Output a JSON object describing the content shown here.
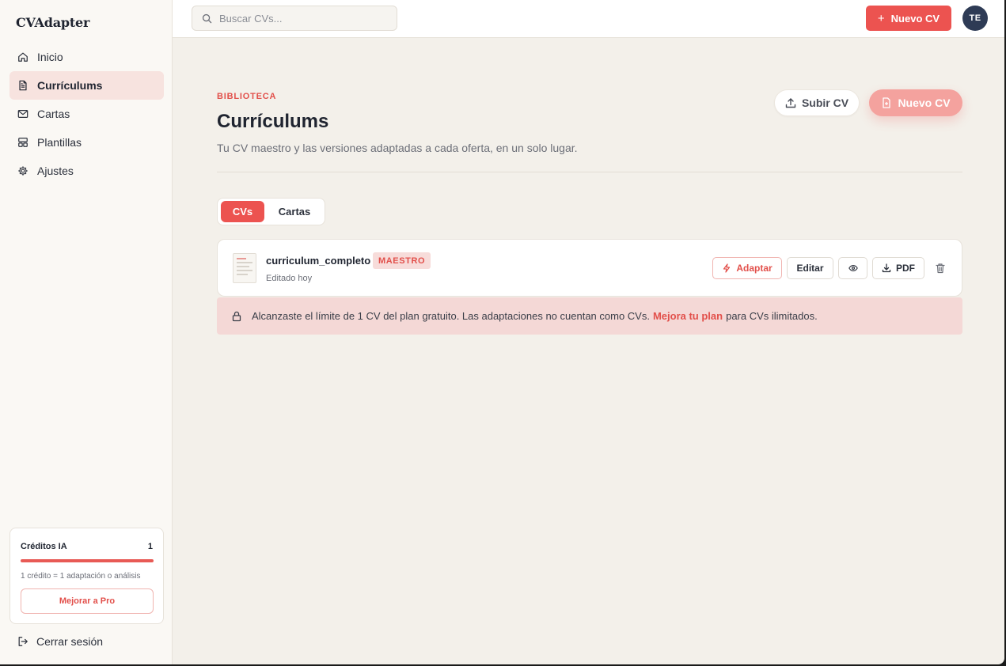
{
  "app": {
    "brand": "CVAdapter"
  },
  "sidebar": {
    "items": [
      {
        "label": "Inicio",
        "icon": "home-icon",
        "active": false
      },
      {
        "label": "Currículums",
        "icon": "document-icon",
        "active": true
      },
      {
        "label": "Cartas",
        "icon": "mail-icon",
        "active": false
      },
      {
        "label": "Plantillas",
        "icon": "template-icon",
        "active": false
      },
      {
        "label": "Ajustes",
        "icon": "gear-icon",
        "active": false
      }
    ],
    "credits": {
      "title": "Créditos IA",
      "count": "1",
      "level": 1.0,
      "note": "1 crédito = 1 adaptación o análisis",
      "upgrade_label": "Mejorar a Pro"
    },
    "logout_label": "Cerrar sesión"
  },
  "topbar": {
    "search_placeholder": "Buscar CVs...",
    "new_cv_label": "Nuevo CV",
    "avatar_initials": "TE"
  },
  "main": {
    "eyebrow": "BIBLIOTECA",
    "title": "Currículums",
    "subtitle": "Tu CV maestro y las versiones adaptadas a cada oferta, en un solo lugar.",
    "upload_label": "Subir CV",
    "new_cv_label": "Nuevo CV",
    "tabs": [
      {
        "label": "CVs",
        "active": true
      },
      {
        "label": "Cartas",
        "active": false
      }
    ],
    "cvs": [
      {
        "name": "curriculum_completo",
        "badge": "MAESTRO",
        "edited": "Editado hoy",
        "actions": {
          "adapt": "Adaptar",
          "edit": "Editar",
          "pdf": "PDF"
        }
      }
    ],
    "limit_notice": {
      "text_before": "Alcanzaste el límite de 1 CV del plan gratuito. Las adaptaciones no cuentan como CVs.",
      "link": "Mejora tu plan",
      "text_after": "para CVs ilimitados."
    }
  },
  "colors": {
    "accent": "#ec5350",
    "accent_soft": "#f4a29e",
    "background": "#f3f0ea",
    "sidebar_active": "#f7e3df",
    "avatar": "#2e3b55"
  }
}
